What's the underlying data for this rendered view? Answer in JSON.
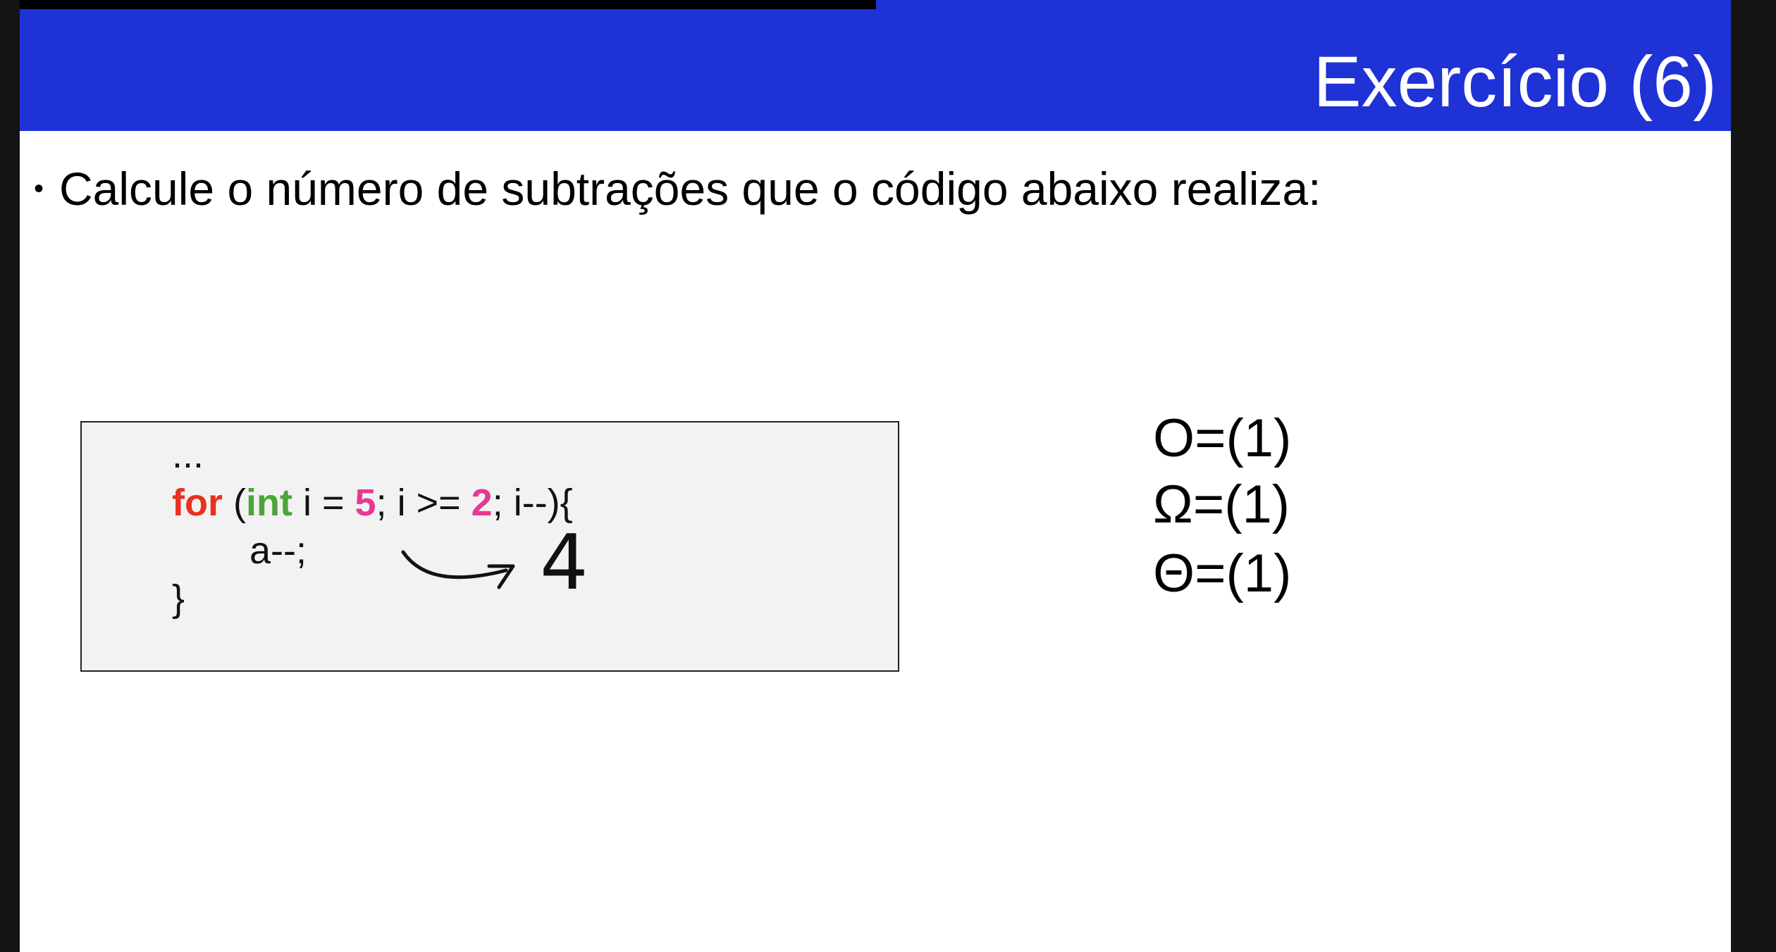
{
  "slide": {
    "title": "Exercício (6)",
    "bullet_marker": "•",
    "bullet_text": "Calcule o número de subtrações que o código abaixo realiza:"
  },
  "code": {
    "ellipsis": "...",
    "for_keyword": "for",
    "paren_open": " (",
    "int_keyword": "int",
    "init_text": " i = ",
    "init_value": "5",
    "cond_text": "; i >= ",
    "cond_value": "2",
    "tail_text": "; i--){",
    "body": "a--;",
    "closing_brace": "}"
  },
  "annotation": {
    "handwritten_answer": "4"
  },
  "complexity": {
    "big_o": "O=(1)",
    "big_omega": "Ω=(1)",
    "big_theta": "Θ=(1)"
  },
  "colors": {
    "title_bar": "#1f32d6",
    "keyword_for": "#e8311f",
    "keyword_int": "#4aa53a",
    "number_literal": "#e6398f",
    "code_box_background": "#f2f2f2"
  }
}
